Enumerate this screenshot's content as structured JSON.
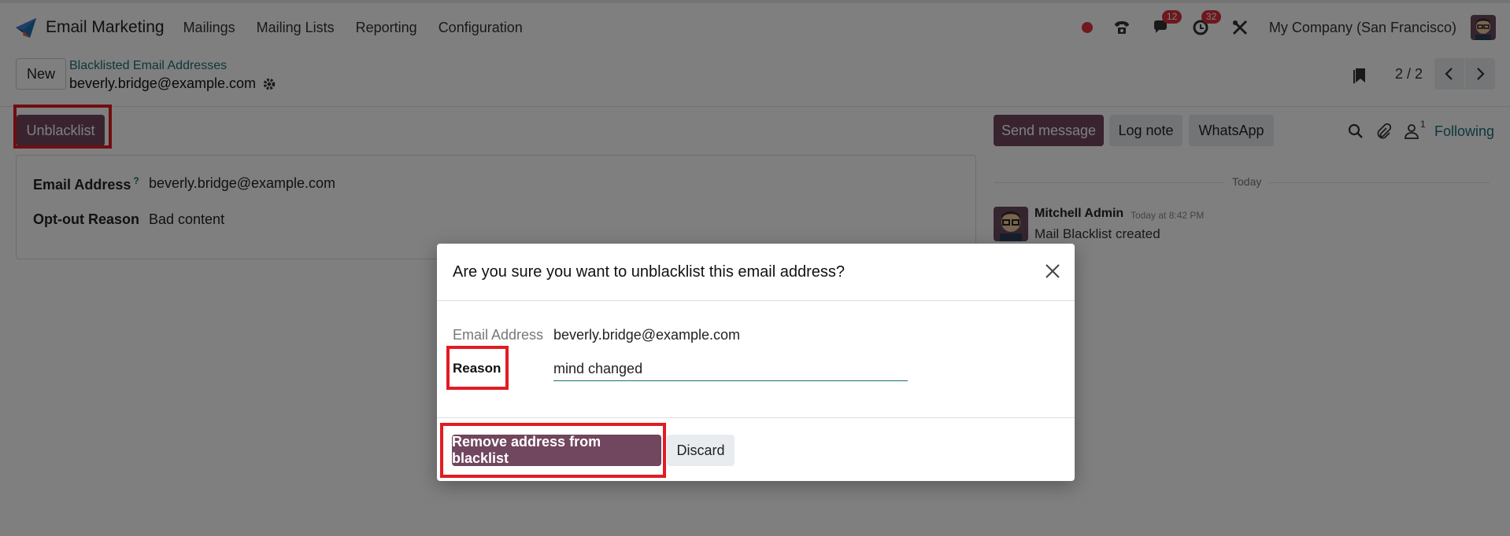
{
  "app": {
    "name": "Email Marketing"
  },
  "menu": [
    "Mailings",
    "Mailing Lists",
    "Reporting",
    "Configuration"
  ],
  "systray": {
    "messages_badge": "12",
    "activities_badge": "32",
    "company": "My Company (San Francisco)"
  },
  "control": {
    "new_label": "New",
    "breadcrumb_parent": "Blacklisted Email Addresses",
    "breadcrumb_current": "beverly.bridge@example.com",
    "pager": "2 / 2"
  },
  "form": {
    "unblacklist_label": "Unblacklist",
    "email_label": "Email Address",
    "email_help": "?",
    "email_value": "beverly.bridge@example.com",
    "reason_label": "Opt-out Reason",
    "reason_value": "Bad content"
  },
  "chatter": {
    "send_message": "Send message",
    "log_note": "Log note",
    "whatsapp": "WhatsApp",
    "followers_count": "1",
    "following": "Following",
    "today": "Today",
    "message": {
      "author": "Mitchell Admin",
      "time": "Today at 8:42 PM",
      "body": "Mail Blacklist created"
    }
  },
  "dialog": {
    "title": "Are you sure you want to unblacklist this email address?",
    "email_label": "Email Address",
    "email_value": "beverly.bridge@example.com",
    "reason_label": "Reason",
    "reason_value": "mind changed",
    "remove_label": "Remove address from blacklist",
    "discard_label": "Discard"
  },
  "colors": {
    "primary": "#71465f",
    "accent": "#1d6e76",
    "badge": "#d9303d",
    "highlight_box": "#e31b23"
  },
  "icons": [
    "email-marketing-logo-icon",
    "phone-icon",
    "chat-icon",
    "activity-clock-icon",
    "tools-icon",
    "gear-icon",
    "bookmark-icon",
    "chevron-left-icon",
    "chevron-right-icon",
    "search-icon",
    "paperclip-icon",
    "person-icon",
    "close-icon"
  ]
}
